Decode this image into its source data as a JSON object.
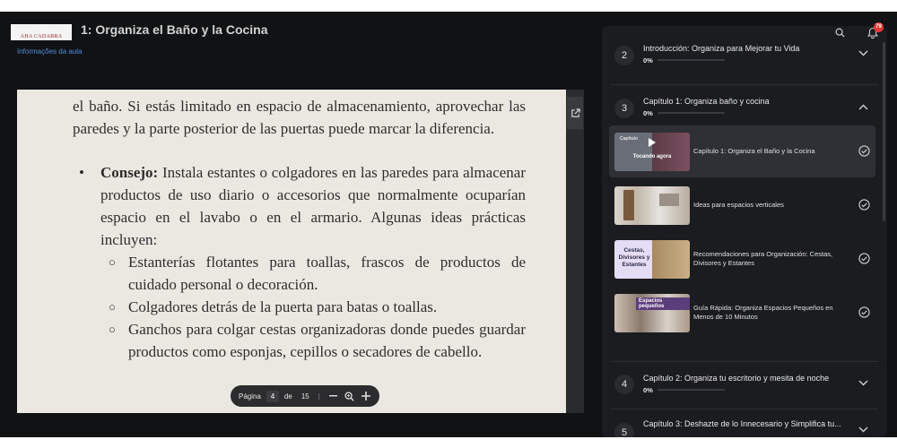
{
  "header": {
    "logo_text": "AHA CADABRA",
    "lesson_title": "1: Organiza el Baño y la Cocina",
    "lesson_info_link": "Informações da aula",
    "notification_count": "79"
  },
  "document": {
    "line1": "el baño. Si estás limitado en espacio de almacenamiento, aprovechar las paredes y la parte posterior de las puertas puede marcar la diferencia.",
    "bullet_label": "Consejo:",
    "bullet_text": " Instala estantes o colgadores en las paredes para almacenar productos de uso diario o accesorios que normalmente ocuparían espacio en el lavabo o en el armario. Algunas ideas prácticas incluyen:",
    "sub_items": [
      "Estanterías flotantes para toallas, frascos de productos de cuidado personal o decoración.",
      "Colgadores detrás de la puerta para batas o toallas.",
      "Ganchos para colgar cestas organizadoras donde puedes guardar productos como esponjas, cepillos o secadores de cabello."
    ]
  },
  "pager": {
    "label": "Página",
    "current": "4",
    "of": "de",
    "total": "15"
  },
  "sidebar": {
    "chapters": [
      {
        "num": "2",
        "title": "Introducción: Organiza para Mejorar tu Vida",
        "pct": "0%"
      },
      {
        "num": "3",
        "title": "Capítulo 1: Organiza baño y cocina",
        "pct": "0%"
      },
      {
        "num": "4",
        "title": "Capítulo 2: Organiza tu escritorio y mesita de noche",
        "pct": "0%"
      },
      {
        "num": "5",
        "title": "Capítulo 3: Deshazte de lo Innecesario y Simplifica tu..."
      }
    ],
    "lessons": [
      {
        "title": "Capítulo 1: Organiza el Baño y la Cocina",
        "thumb_caption": "Capítulo",
        "now_playing": "Tocando agora"
      },
      {
        "title": "Ideas para espacios verticales"
      },
      {
        "title": "Recomendaciones para Organización: Cestas, Divisores y Estantes",
        "thumb_caption": "Cestas, Divisores y Estantes"
      },
      {
        "title": "Guía Rápida: Organiza Espacios Pequeños en Menos de 10 Minutos",
        "thumb_caption": "Espacios pequeños"
      }
    ]
  },
  "colors": {
    "accent": "#4d8fe0",
    "badge": "#e53935",
    "background": "#111214",
    "sidebar": "#1b1c1f"
  },
  "icons": [
    "external-link-icon",
    "zoom-out-icon",
    "zoom-in-icon",
    "search-icon",
    "bell-icon",
    "chevron-down-icon",
    "chevron-up-icon",
    "check-circle-icon",
    "play-icon"
  ]
}
